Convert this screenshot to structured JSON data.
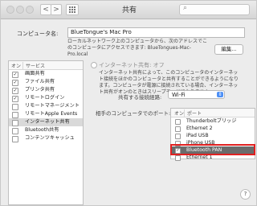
{
  "window": {
    "title": "共有"
  },
  "toolbar": {
    "back_glyph": "<",
    "forward_glyph": ">",
    "search_icon_glyph": "⌕",
    "search_placeholder": ""
  },
  "computer_name": {
    "label": "コンピュータ名:",
    "value": "BlueTongue's Mac Pro",
    "description": "ローカルネットワーク上のコンピュータから、次のアドレスでこのコンピュータにアクセスできます: BlueTongues-Mac-Pro.local",
    "edit_button": "編集..."
  },
  "services": {
    "header_on": "オン",
    "header_service": "サービス",
    "items": [
      {
        "label": "画面共有",
        "checked": true,
        "selected": false
      },
      {
        "label": "ファイル共有",
        "checked": true,
        "selected": false
      },
      {
        "label": "プリンタ共有",
        "checked": true,
        "selected": false
      },
      {
        "label": "リモートログイン",
        "checked": true,
        "selected": false
      },
      {
        "label": "リモートマネージメント",
        "checked": false,
        "selected": false
      },
      {
        "label": "リモートApple Events",
        "checked": false,
        "selected": false
      },
      {
        "label": "インターネット共有",
        "checked": false,
        "selected": true
      },
      {
        "label": "Bluetooth共有",
        "checked": false,
        "selected": false
      },
      {
        "label": "コンテンツキャッシュ",
        "checked": false,
        "selected": false
      }
    ]
  },
  "internet_sharing": {
    "status": "インターネット共有: オフ",
    "description": "インターネット共有によって、このコンピュータのインターネット接続をほかのコンピュータと共有することができるようになります。コンピュータが電源に接続されている場合、インターネット共有がオンのときはスリープモードになりません。",
    "share_from_label": "共有する接続経路:",
    "share_from_value": "Wi-Fi",
    "ports_label": "相手のコンピュータでのポート:",
    "ports_header_on": "オン",
    "ports_header_port": "ポート",
    "ports": [
      {
        "label": "Thunderboltブリッジ",
        "checked": false,
        "selected": false
      },
      {
        "label": "Ethernet 2",
        "checked": false,
        "selected": false
      },
      {
        "label": "iPad USB",
        "checked": false,
        "selected": false
      },
      {
        "label": "iPhone USB",
        "checked": false,
        "selected": false
      },
      {
        "label": "Bluetooth PAN",
        "checked": true,
        "selected": true
      },
      {
        "label": "Ethernet 1",
        "checked": false,
        "selected": false
      }
    ],
    "highlight_color": "#e02020"
  },
  "help": {
    "label": "?"
  }
}
